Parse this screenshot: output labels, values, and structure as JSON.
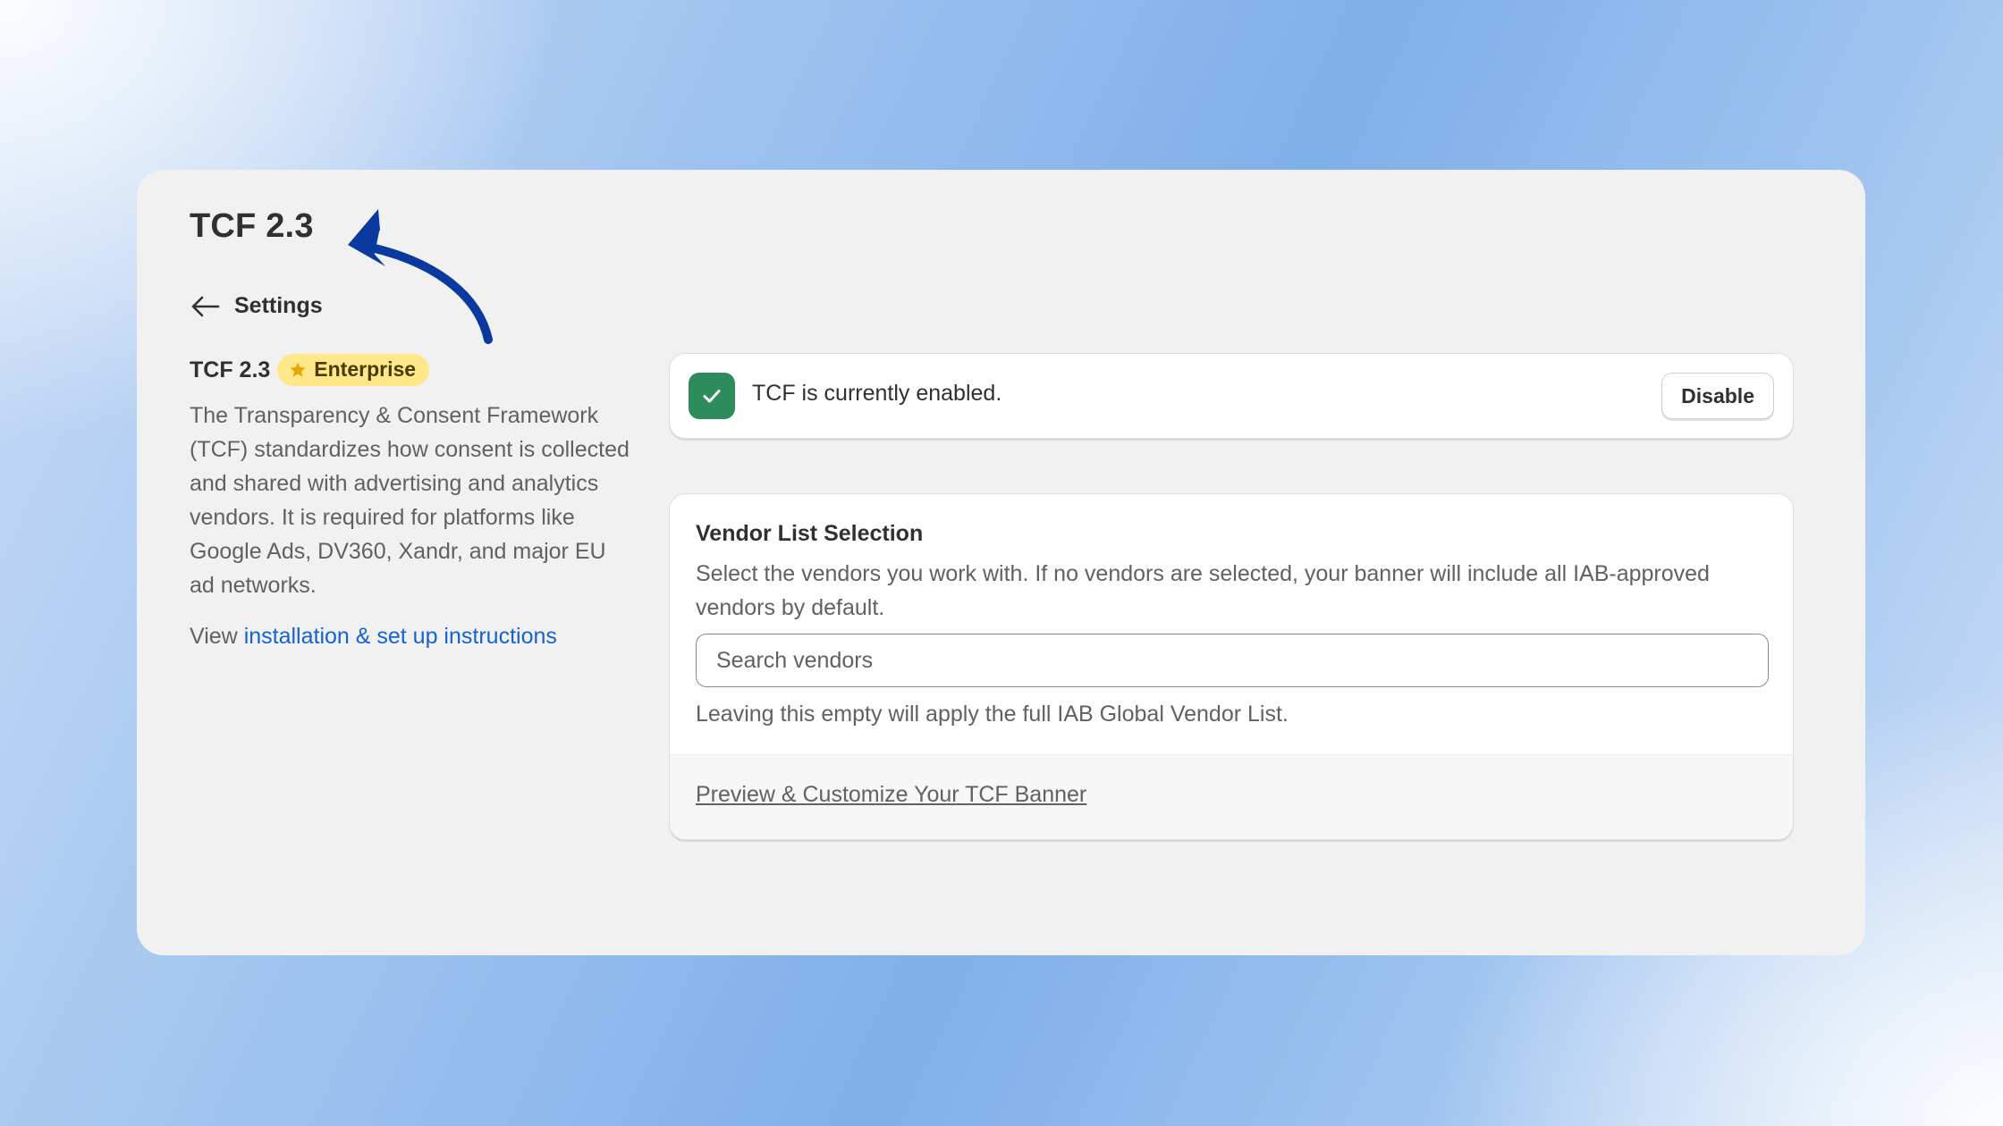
{
  "page": {
    "title": "TCF 2.3",
    "back_label": "Settings"
  },
  "section": {
    "title": "TCF 2.3",
    "badge": "Enterprise",
    "description": "The Transparency & Consent Framework (TCF) standardizes how consent is collected and shared with advertising and analytics vendors. It is required for platforms like Google Ads, DV360, Xandr, and major EU ad networks.",
    "view_prefix": "View ",
    "instructions_link": "installation & set up instructions"
  },
  "status": {
    "text": "TCF is currently enabled.",
    "disable_label": "Disable"
  },
  "vendor": {
    "title": "Vendor List Selection",
    "description": "Select the vendors you work with. If no vendors are selected, your banner will include all IAB-approved vendors by default.",
    "search_placeholder": "Search vendors",
    "search_value": "",
    "help_text": "Leaving this empty will apply the full IAB Global Vendor List.",
    "preview_link": "Preview & Customize Your TCF Banner"
  },
  "colors": {
    "accent_link": "#1662d1",
    "success": "#2e8b5b",
    "badge_bg": "#ffe88a",
    "annotation_arrow": "#0b3a9e"
  },
  "icons": {
    "back": "arrow-left-icon",
    "badge": "star-icon",
    "status": "checkmark-icon",
    "annotation": "curved-arrow-icon"
  }
}
